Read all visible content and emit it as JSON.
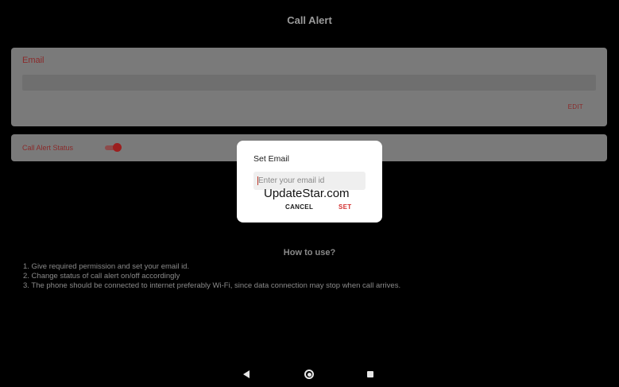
{
  "app_bar": {
    "title": "Call Alert"
  },
  "email_card": {
    "label": "Email",
    "value": "",
    "edit_label": "EDIT"
  },
  "status_card": {
    "label": "Call Alert Status",
    "toggle_on": true
  },
  "how_to": {
    "title": "How to use?",
    "steps": [
      "1. Give required permission and set your email id.",
      "2. Change status of call alert on/off accordingly",
      "3. The phone should be connected to internet preferably Wi-Fi, since data connection may stop when call arrives."
    ]
  },
  "dialog": {
    "title": "Set Email",
    "input_value": "",
    "input_placeholder": "Enter your email id",
    "watermark": "UpdateStar.com",
    "cancel_label": "CANCEL",
    "set_label": "SET"
  },
  "nav_bar": {
    "icons": [
      "back-icon",
      "home-icon",
      "recents-icon"
    ]
  },
  "colors": {
    "background": "#000000",
    "card": "#7a7a7a",
    "accent_dimmed": "#8a2a2a",
    "accent": "#d32f2f",
    "dialog": "#ffffff"
  }
}
